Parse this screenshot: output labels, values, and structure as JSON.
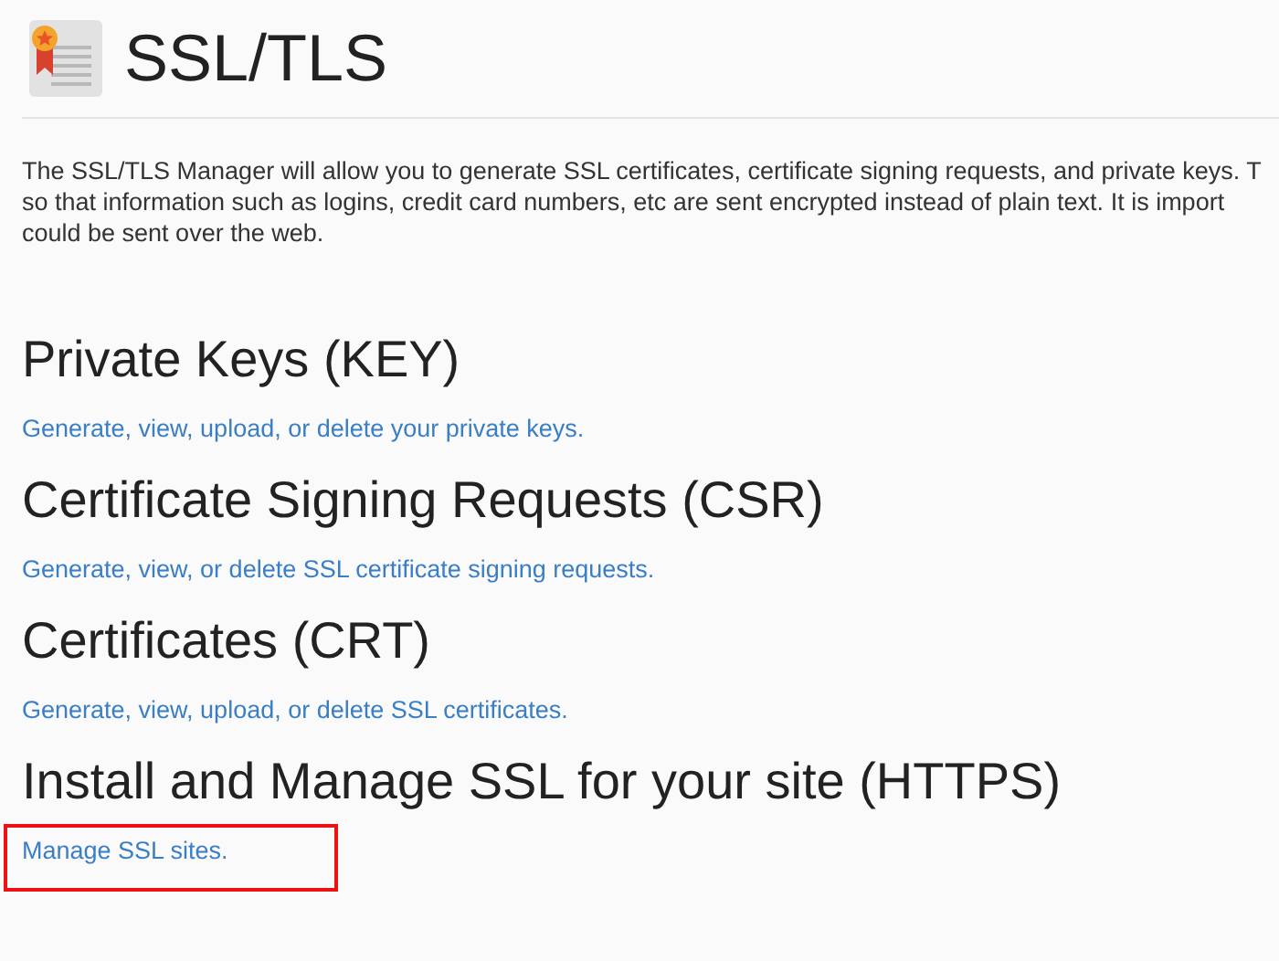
{
  "page": {
    "title": "SSL/TLS"
  },
  "description": [
    "The SSL/TLS Manager will allow you to generate SSL certificates, certificate signing requests, and private keys. T",
    "so that information such as logins, credit card numbers, etc are sent encrypted instead of plain text. It is import",
    "could be sent over the web."
  ],
  "sections": [
    {
      "heading": "Private Keys (KEY)",
      "link": "Generate, view, upload, or delete your private keys.",
      "highlighted": false
    },
    {
      "heading": "Certificate Signing Requests (CSR)",
      "link": "Generate, view, or delete SSL certificate signing requests.",
      "highlighted": false
    },
    {
      "heading": "Certificates (CRT)",
      "link": "Generate, view, upload, or delete SSL certificates.",
      "highlighted": false
    },
    {
      "heading": "Install and Manage SSL for your site (HTTPS)",
      "link": "Manage SSL sites.",
      "highlighted": true
    }
  ]
}
